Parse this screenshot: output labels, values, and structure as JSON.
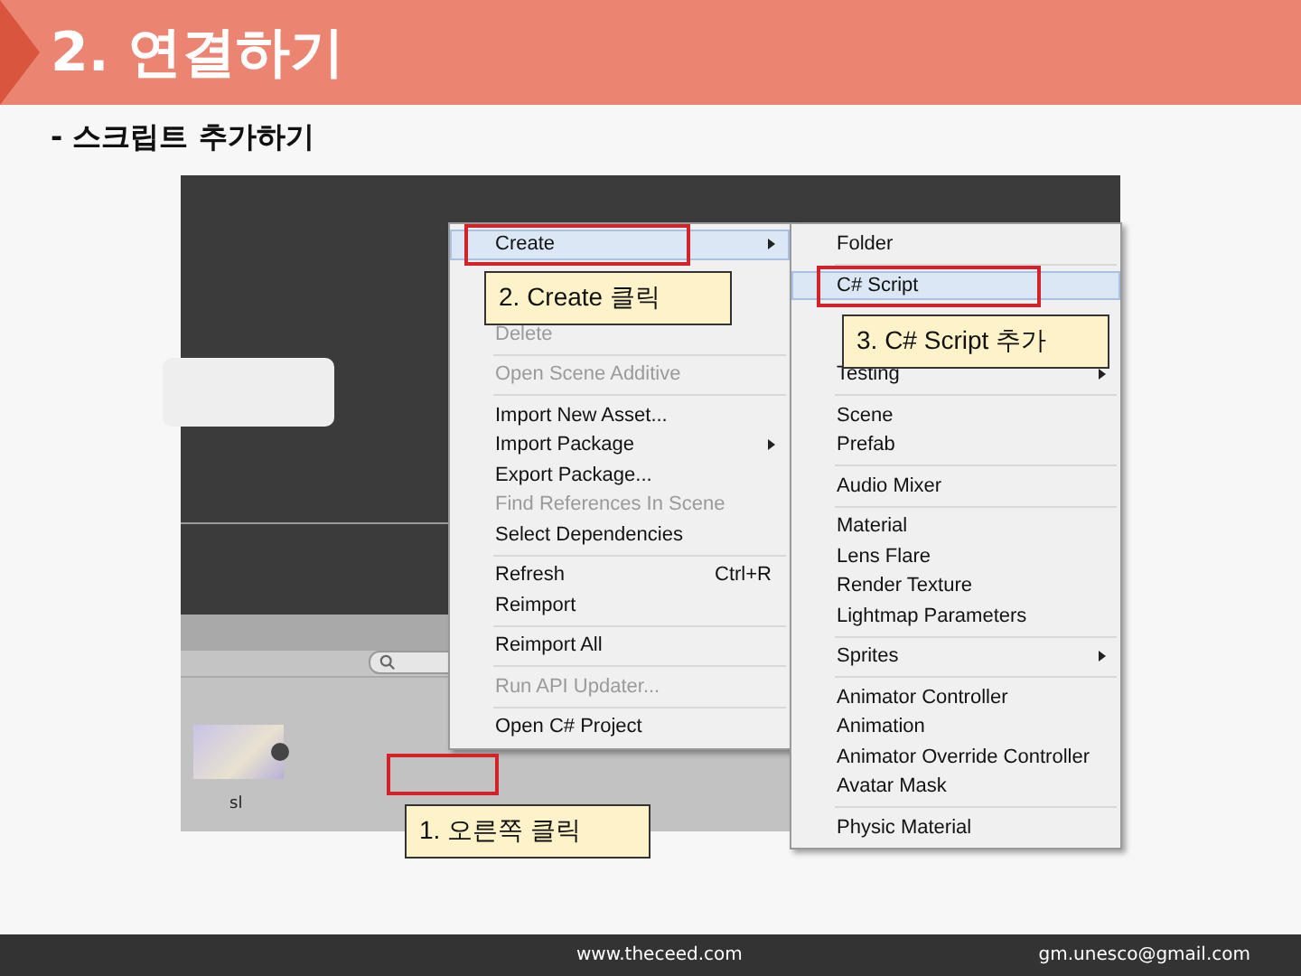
{
  "slide": {
    "title": "2. 연결하기",
    "subtitle": "- 스크립트 추가하기"
  },
  "screenshot": {
    "asset_label": "sl",
    "context_menu": [
      {
        "kind": "item",
        "label": "Create",
        "submenu": true,
        "selected": true,
        "disabled": false
      },
      {
        "kind": "covered"
      },
      {
        "kind": "covered"
      },
      {
        "kind": "item",
        "label": "Delete",
        "submenu": false,
        "selected": false,
        "disabled": true
      },
      {
        "kind": "separator"
      },
      {
        "kind": "item",
        "label": "Open Scene Additive",
        "submenu": false,
        "selected": false,
        "disabled": true
      },
      {
        "kind": "separator"
      },
      {
        "kind": "item",
        "label": "Import New Asset...",
        "submenu": false,
        "selected": false,
        "disabled": false
      },
      {
        "kind": "item",
        "label": "Import Package",
        "submenu": true,
        "selected": false,
        "disabled": false
      },
      {
        "kind": "item",
        "label": "Export Package...",
        "submenu": false,
        "selected": false,
        "disabled": false
      },
      {
        "kind": "item",
        "label": "Find References In Scene",
        "submenu": false,
        "selected": false,
        "disabled": true
      },
      {
        "kind": "item",
        "label": "Select Dependencies",
        "submenu": false,
        "selected": false,
        "disabled": false
      },
      {
        "kind": "separator"
      },
      {
        "kind": "item",
        "label": "Refresh",
        "shortcut": "Ctrl+R",
        "submenu": false,
        "selected": false,
        "disabled": false
      },
      {
        "kind": "item",
        "label": "Reimport",
        "submenu": false,
        "selected": false,
        "disabled": false
      },
      {
        "kind": "separator"
      },
      {
        "kind": "item",
        "label": "Reimport All",
        "submenu": false,
        "selected": false,
        "disabled": false
      },
      {
        "kind": "separator"
      },
      {
        "kind": "item",
        "label": "Run API Updater...",
        "submenu": false,
        "selected": false,
        "disabled": true
      },
      {
        "kind": "separator"
      },
      {
        "kind": "item",
        "label": "Open C# Project",
        "submenu": false,
        "selected": false,
        "disabled": false
      }
    ],
    "create_submenu": [
      {
        "kind": "item",
        "label": "Folder",
        "submenu": false,
        "selected": false,
        "disabled": false
      },
      {
        "kind": "separator"
      },
      {
        "kind": "item",
        "label": "C# Script",
        "submenu": false,
        "selected": true,
        "disabled": false
      },
      {
        "kind": "covered"
      },
      {
        "kind": "covered"
      },
      {
        "kind": "item",
        "label": "Testing",
        "submenu": true,
        "selected": false,
        "disabled": false
      },
      {
        "kind": "separator"
      },
      {
        "kind": "item",
        "label": "Scene",
        "submenu": false,
        "selected": false,
        "disabled": false
      },
      {
        "kind": "item",
        "label": "Prefab",
        "submenu": false,
        "selected": false,
        "disabled": false
      },
      {
        "kind": "separator"
      },
      {
        "kind": "item",
        "label": "Audio Mixer",
        "submenu": false,
        "selected": false,
        "disabled": false
      },
      {
        "kind": "separator"
      },
      {
        "kind": "item",
        "label": "Material",
        "submenu": false,
        "selected": false,
        "disabled": false
      },
      {
        "kind": "item",
        "label": "Lens Flare",
        "submenu": false,
        "selected": false,
        "disabled": false
      },
      {
        "kind": "item",
        "label": "Render Texture",
        "submenu": false,
        "selected": false,
        "disabled": false
      },
      {
        "kind": "item",
        "label": "Lightmap Parameters",
        "submenu": false,
        "selected": false,
        "disabled": false
      },
      {
        "kind": "separator"
      },
      {
        "kind": "item",
        "label": "Sprites",
        "submenu": true,
        "selected": false,
        "disabled": false
      },
      {
        "kind": "separator"
      },
      {
        "kind": "item",
        "label": "Animator Controller",
        "submenu": false,
        "selected": false,
        "disabled": false
      },
      {
        "kind": "item",
        "label": "Animation",
        "submenu": false,
        "selected": false,
        "disabled": false
      },
      {
        "kind": "item",
        "label": "Animator Override Controller",
        "submenu": false,
        "selected": false,
        "disabled": false
      },
      {
        "kind": "item",
        "label": "Avatar Mask",
        "submenu": false,
        "selected": false,
        "disabled": false
      },
      {
        "kind": "separator"
      },
      {
        "kind": "item",
        "label": "Physic Material",
        "submenu": false,
        "selected": false,
        "disabled": false
      }
    ],
    "callouts": [
      {
        "kind": "create",
        "text": "2. Create 클릭"
      },
      {
        "kind": "script",
        "text": "3. C# Script 추가"
      },
      {
        "kind": "click",
        "text": "1. 오른쪽 클릭"
      }
    ]
  },
  "footer": {
    "website": "www.theceed.com",
    "email": "gm.unesco@gmail.com"
  }
}
